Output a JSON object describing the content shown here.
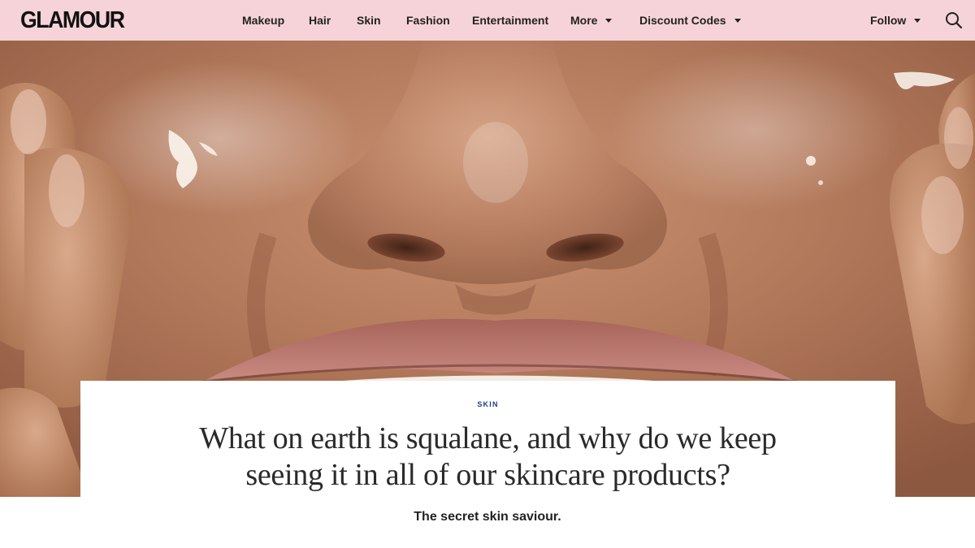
{
  "brand": {
    "logo_text": "GLAMOUR"
  },
  "nav": {
    "items": [
      {
        "label": "Makeup",
        "has_dropdown": false
      },
      {
        "label": "Hair",
        "has_dropdown": false
      },
      {
        "label": "Skin",
        "has_dropdown": false
      },
      {
        "label": "Fashion",
        "has_dropdown": false
      },
      {
        "label": "Entertainment",
        "has_dropdown": false
      },
      {
        "label": "More",
        "has_dropdown": true
      },
      {
        "label": "Discount Codes",
        "has_dropdown": true
      }
    ],
    "follow_label": "Follow",
    "search_icon": "search-icon",
    "background_color": "#f6d3d9"
  },
  "hero": {
    "subject": "close-up of face with glistening skin oil"
  },
  "article": {
    "category": "SKIN",
    "headline_line1": "What on earth is squalane, and why do we keep",
    "headline_line2": "seeing it in all of our skincare products?",
    "dek": "The secret skin saviour.",
    "category_color": "#1f3f8a"
  }
}
